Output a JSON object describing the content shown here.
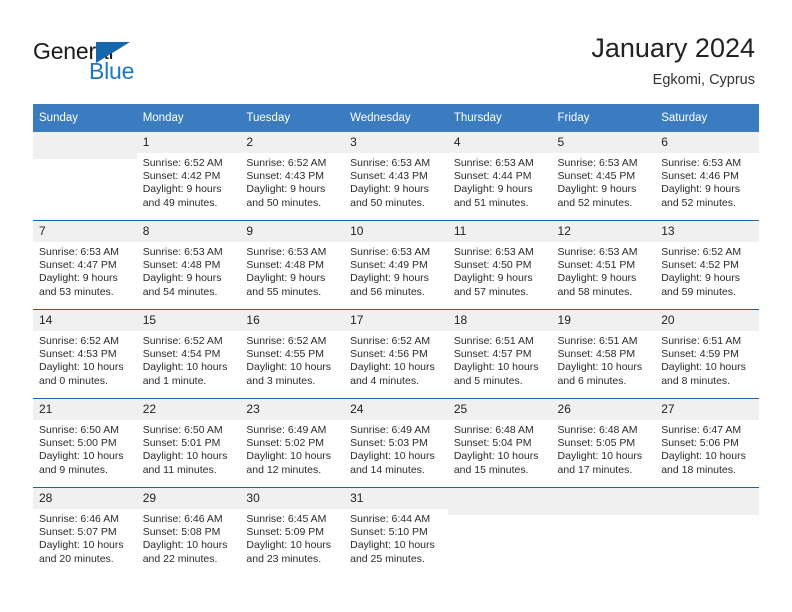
{
  "brand": {
    "name_top": "General",
    "name_bottom": "Blue",
    "flag_icon": "triangle-flag-icon",
    "accent_color": "#1566ab",
    "blue_text_color": "#1f77c2"
  },
  "header": {
    "title": "January 2024",
    "subtitle": "Egkomi, Cyprus"
  },
  "colors": {
    "header_band": "#3a7cbf",
    "row_separator": "#1f63a5",
    "daynum_band": "#f0f0f0",
    "cell_background": "#ffffff",
    "text": "#222222"
  },
  "weekday_headers": [
    "Sunday",
    "Monday",
    "Tuesday",
    "Wednesday",
    "Thursday",
    "Friday",
    "Saturday"
  ],
  "weeks": [
    [
      {
        "day": "",
        "sunrise": "",
        "sunset": "",
        "daylight_line1": "",
        "daylight_line2": ""
      },
      {
        "day": "1",
        "sunrise": "Sunrise: 6:52 AM",
        "sunset": "Sunset: 4:42 PM",
        "daylight_line1": "Daylight: 9 hours",
        "daylight_line2": "and 49 minutes."
      },
      {
        "day": "2",
        "sunrise": "Sunrise: 6:52 AM",
        "sunset": "Sunset: 4:43 PM",
        "daylight_line1": "Daylight: 9 hours",
        "daylight_line2": "and 50 minutes."
      },
      {
        "day": "3",
        "sunrise": "Sunrise: 6:53 AM",
        "sunset": "Sunset: 4:43 PM",
        "daylight_line1": "Daylight: 9 hours",
        "daylight_line2": "and 50 minutes."
      },
      {
        "day": "4",
        "sunrise": "Sunrise: 6:53 AM",
        "sunset": "Sunset: 4:44 PM",
        "daylight_line1": "Daylight: 9 hours",
        "daylight_line2": "and 51 minutes."
      },
      {
        "day": "5",
        "sunrise": "Sunrise: 6:53 AM",
        "sunset": "Sunset: 4:45 PM",
        "daylight_line1": "Daylight: 9 hours",
        "daylight_line2": "and 52 minutes."
      },
      {
        "day": "6",
        "sunrise": "Sunrise: 6:53 AM",
        "sunset": "Sunset: 4:46 PM",
        "daylight_line1": "Daylight: 9 hours",
        "daylight_line2": "and 52 minutes."
      }
    ],
    [
      {
        "day": "7",
        "sunrise": "Sunrise: 6:53 AM",
        "sunset": "Sunset: 4:47 PM",
        "daylight_line1": "Daylight: 9 hours",
        "daylight_line2": "and 53 minutes."
      },
      {
        "day": "8",
        "sunrise": "Sunrise: 6:53 AM",
        "sunset": "Sunset: 4:48 PM",
        "daylight_line1": "Daylight: 9 hours",
        "daylight_line2": "and 54 minutes."
      },
      {
        "day": "9",
        "sunrise": "Sunrise: 6:53 AM",
        "sunset": "Sunset: 4:48 PM",
        "daylight_line1": "Daylight: 9 hours",
        "daylight_line2": "and 55 minutes."
      },
      {
        "day": "10",
        "sunrise": "Sunrise: 6:53 AM",
        "sunset": "Sunset: 4:49 PM",
        "daylight_line1": "Daylight: 9 hours",
        "daylight_line2": "and 56 minutes."
      },
      {
        "day": "11",
        "sunrise": "Sunrise: 6:53 AM",
        "sunset": "Sunset: 4:50 PM",
        "daylight_line1": "Daylight: 9 hours",
        "daylight_line2": "and 57 minutes."
      },
      {
        "day": "12",
        "sunrise": "Sunrise: 6:53 AM",
        "sunset": "Sunset: 4:51 PM",
        "daylight_line1": "Daylight: 9 hours",
        "daylight_line2": "and 58 minutes."
      },
      {
        "day": "13",
        "sunrise": "Sunrise: 6:52 AM",
        "sunset": "Sunset: 4:52 PM",
        "daylight_line1": "Daylight: 9 hours",
        "daylight_line2": "and 59 minutes."
      }
    ],
    [
      {
        "day": "14",
        "sunrise": "Sunrise: 6:52 AM",
        "sunset": "Sunset: 4:53 PM",
        "daylight_line1": "Daylight: 10 hours",
        "daylight_line2": "and 0 minutes."
      },
      {
        "day": "15",
        "sunrise": "Sunrise: 6:52 AM",
        "sunset": "Sunset: 4:54 PM",
        "daylight_line1": "Daylight: 10 hours",
        "daylight_line2": "and 1 minute."
      },
      {
        "day": "16",
        "sunrise": "Sunrise: 6:52 AM",
        "sunset": "Sunset: 4:55 PM",
        "daylight_line1": "Daylight: 10 hours",
        "daylight_line2": "and 3 minutes."
      },
      {
        "day": "17",
        "sunrise": "Sunrise: 6:52 AM",
        "sunset": "Sunset: 4:56 PM",
        "daylight_line1": "Daylight: 10 hours",
        "daylight_line2": "and 4 minutes."
      },
      {
        "day": "18",
        "sunrise": "Sunrise: 6:51 AM",
        "sunset": "Sunset: 4:57 PM",
        "daylight_line1": "Daylight: 10 hours",
        "daylight_line2": "and 5 minutes."
      },
      {
        "day": "19",
        "sunrise": "Sunrise: 6:51 AM",
        "sunset": "Sunset: 4:58 PM",
        "daylight_line1": "Daylight: 10 hours",
        "daylight_line2": "and 6 minutes."
      },
      {
        "day": "20",
        "sunrise": "Sunrise: 6:51 AM",
        "sunset": "Sunset: 4:59 PM",
        "daylight_line1": "Daylight: 10 hours",
        "daylight_line2": "and 8 minutes."
      }
    ],
    [
      {
        "day": "21",
        "sunrise": "Sunrise: 6:50 AM",
        "sunset": "Sunset: 5:00 PM",
        "daylight_line1": "Daylight: 10 hours",
        "daylight_line2": "and 9 minutes."
      },
      {
        "day": "22",
        "sunrise": "Sunrise: 6:50 AM",
        "sunset": "Sunset: 5:01 PM",
        "daylight_line1": "Daylight: 10 hours",
        "daylight_line2": "and 11 minutes."
      },
      {
        "day": "23",
        "sunrise": "Sunrise: 6:49 AM",
        "sunset": "Sunset: 5:02 PM",
        "daylight_line1": "Daylight: 10 hours",
        "daylight_line2": "and 12 minutes."
      },
      {
        "day": "24",
        "sunrise": "Sunrise: 6:49 AM",
        "sunset": "Sunset: 5:03 PM",
        "daylight_line1": "Daylight: 10 hours",
        "daylight_line2": "and 14 minutes."
      },
      {
        "day": "25",
        "sunrise": "Sunrise: 6:48 AM",
        "sunset": "Sunset: 5:04 PM",
        "daylight_line1": "Daylight: 10 hours",
        "daylight_line2": "and 15 minutes."
      },
      {
        "day": "26",
        "sunrise": "Sunrise: 6:48 AM",
        "sunset": "Sunset: 5:05 PM",
        "daylight_line1": "Daylight: 10 hours",
        "daylight_line2": "and 17 minutes."
      },
      {
        "day": "27",
        "sunrise": "Sunrise: 6:47 AM",
        "sunset": "Sunset: 5:06 PM",
        "daylight_line1": "Daylight: 10 hours",
        "daylight_line2": "and 18 minutes."
      }
    ],
    [
      {
        "day": "28",
        "sunrise": "Sunrise: 6:46 AM",
        "sunset": "Sunset: 5:07 PM",
        "daylight_line1": "Daylight: 10 hours",
        "daylight_line2": "and 20 minutes."
      },
      {
        "day": "29",
        "sunrise": "Sunrise: 6:46 AM",
        "sunset": "Sunset: 5:08 PM",
        "daylight_line1": "Daylight: 10 hours",
        "daylight_line2": "and 22 minutes."
      },
      {
        "day": "30",
        "sunrise": "Sunrise: 6:45 AM",
        "sunset": "Sunset: 5:09 PM",
        "daylight_line1": "Daylight: 10 hours",
        "daylight_line2": "and 23 minutes."
      },
      {
        "day": "31",
        "sunrise": "Sunrise: 6:44 AM",
        "sunset": "Sunset: 5:10 PM",
        "daylight_line1": "Daylight: 10 hours",
        "daylight_line2": "and 25 minutes."
      },
      {
        "day": "",
        "sunrise": "",
        "sunset": "",
        "daylight_line1": "",
        "daylight_line2": ""
      },
      {
        "day": "",
        "sunrise": "",
        "sunset": "",
        "daylight_line1": "",
        "daylight_line2": ""
      },
      {
        "day": "",
        "sunrise": "",
        "sunset": "",
        "daylight_line1": "",
        "daylight_line2": ""
      }
    ]
  ]
}
